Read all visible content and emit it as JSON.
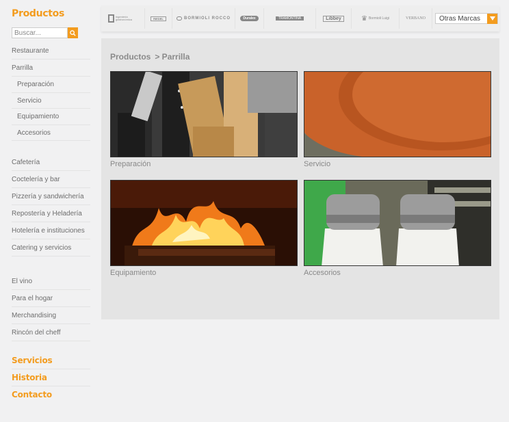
{
  "sidebar": {
    "title": "Productos",
    "search_placeholder": "Buscar...",
    "items": [
      {
        "label": "Restaurante"
      },
      {
        "label": "Parrilla"
      },
      {
        "label": "Preparación"
      },
      {
        "label": "Servicio"
      },
      {
        "label": "Equipamiento"
      },
      {
        "label": "Accesorios"
      },
      {
        "label": "Cafetería"
      },
      {
        "label": "Coctelería y bar"
      },
      {
        "label": "Pizzería y sandwichería"
      },
      {
        "label": "Repostería y Heladería"
      },
      {
        "label": "Hotelería e instituciones"
      },
      {
        "label": "Catering y servicios"
      },
      {
        "label": "El vino"
      },
      {
        "label": "Para el hogar"
      },
      {
        "label": "Merchandising"
      },
      {
        "label": "Rincón del cheff"
      }
    ],
    "links": {
      "servicios": "Servicios",
      "historia": "Historia",
      "contacto": "Contacto"
    }
  },
  "brands": {
    "logos": [
      "bormioli-rocco-icon",
      "libbey-icon",
      "verbano-icon"
    ],
    "b1": "ingeniería gastronómica",
    "b2": "RIEDEL",
    "b3": "BORMIOLI ROCCO",
    "b4": "Duralex",
    "b5": "TRAMONTINA",
    "b6": "Libbey",
    "b7": "Bormioli Luigi",
    "b8": "VERBANO",
    "select_value": "Otras Marcas"
  },
  "breadcrumb": {
    "root": "Productos",
    "current": "> Parrilla"
  },
  "tiles": {
    "t1": "Preparación",
    "t2": "Servicio",
    "t3": "Equipamiento",
    "t4": "Accesorios"
  },
  "colors": {
    "accent": "#f39c1f",
    "panel": "#e4e4e4",
    "background": "#f1f1f2"
  }
}
